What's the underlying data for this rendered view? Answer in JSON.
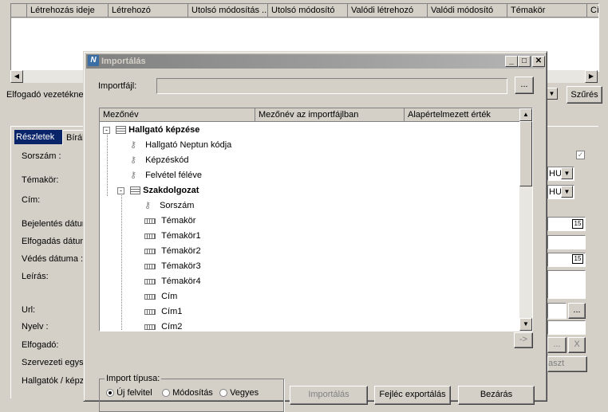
{
  "background": {
    "grid_columns": [
      "",
      "Létrehozás ideje",
      "Létrehozó",
      "Utolsó módosítás ...",
      "Utolsó módosító",
      "Valódi létrehozó",
      "Valódi módosító",
      "Témakör",
      "Cí"
    ],
    "elfogado_label": "Elfogadó vezetékne",
    "szures_label": "Szűrés",
    "tab_reszletek": "Részletek",
    "tab_biral": "Bírál",
    "form_labels": [
      "Sorszám :",
      "Témakör:",
      "Cím:",
      "Bejelentés dátur",
      "Elfogadás dátum",
      "Védés dátuma :",
      "Leírás:",
      "Url:",
      "Nyelv :",
      "Elfogadó:",
      "Szervezeti egyse",
      "Hallgatók / képz"
    ],
    "hu_label": "HU",
    "date_icon": "15",
    "ellipsis": "...",
    "x_label": "X",
    "aszt_label": "aszt"
  },
  "dialog": {
    "title": "Importálás",
    "importfajl_label": "Importfájl:",
    "browse_label": "...",
    "tree_headers": [
      "Mezőnév",
      "Mezőnév az importfájlban",
      "Alapértelmezett érték"
    ],
    "tree_items": [
      {
        "label": "Hallgató képzése",
        "kind": "table",
        "bold": true,
        "level": 0
      },
      {
        "label": "Hallgató Neptun kódja",
        "kind": "key",
        "bold": false,
        "level": 1
      },
      {
        "label": "Képzéskód",
        "kind": "key",
        "bold": false,
        "level": 1
      },
      {
        "label": "Felvétel féléve",
        "kind": "key",
        "bold": false,
        "level": 1
      },
      {
        "label": "Szakdolgozat",
        "kind": "table",
        "bold": true,
        "level": 0
      },
      {
        "label": "Sorszám",
        "kind": "key",
        "bold": false,
        "level": 2
      },
      {
        "label": "Témakör",
        "kind": "field",
        "bold": false,
        "level": 2
      },
      {
        "label": "Témakör1",
        "kind": "field",
        "bold": false,
        "level": 2
      },
      {
        "label": "Témakör2",
        "kind": "field",
        "bold": false,
        "level": 2
      },
      {
        "label": "Témakör3",
        "kind": "field",
        "bold": false,
        "level": 2
      },
      {
        "label": "Témakör4",
        "kind": "field",
        "bold": false,
        "level": 2
      },
      {
        "label": "Cím",
        "kind": "field",
        "bold": false,
        "level": 2
      },
      {
        "label": "Cím1",
        "kind": "field",
        "bold": false,
        "level": 2
      },
      {
        "label": "Cím2",
        "kind": "field",
        "bold": false,
        "level": 2
      }
    ],
    "arrow_button": "->",
    "import_type_label": "Import típusa:",
    "radio_options": [
      "Új felvitel",
      "Módosítás",
      "Vegyes"
    ],
    "selected_radio": "Új felvitel",
    "import_button": "Importálás",
    "header_export_button": "Fejléc exportálás",
    "close_button": "Bezárás"
  }
}
